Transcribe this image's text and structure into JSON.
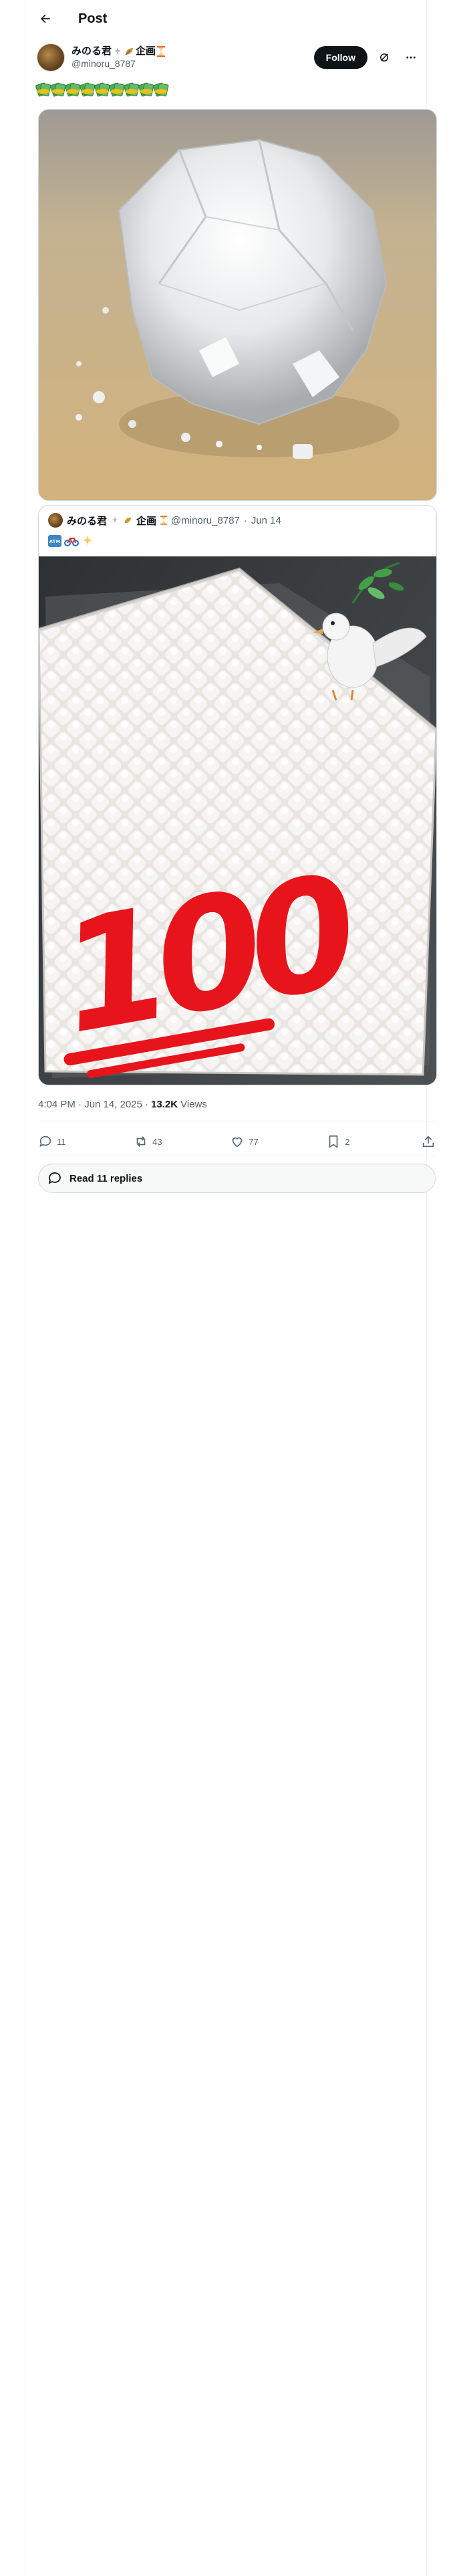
{
  "header": {
    "title": "Post"
  },
  "author": {
    "name": "みのる君",
    "badge_suffix": "企画",
    "handle": "@minoru_8787",
    "follow_label": "Follow"
  },
  "post": {
    "emoji_count": 9,
    "emoji_name": "money-with-wings"
  },
  "quote": {
    "name": "みのる君",
    "badge_suffix": "企画",
    "handle": "@minoru_8787",
    "separator": "·",
    "date": "Jun 14",
    "sticker_text": "100"
  },
  "meta": {
    "time": "4:04 PM · Jun 14, 2025 · ",
    "views_count": "13.2K",
    "views_label": " Views"
  },
  "actions": {
    "replies": "11",
    "reposts": "43",
    "likes": "77",
    "bookmarks": "2"
  },
  "read_replies": {
    "label": "Read 11 replies"
  },
  "colors": {
    "text": "#0f1419",
    "secondary": "#536471",
    "border": "#cfd9de",
    "follow_bg": "#0f1419",
    "sticker_red": "#e8141c"
  }
}
